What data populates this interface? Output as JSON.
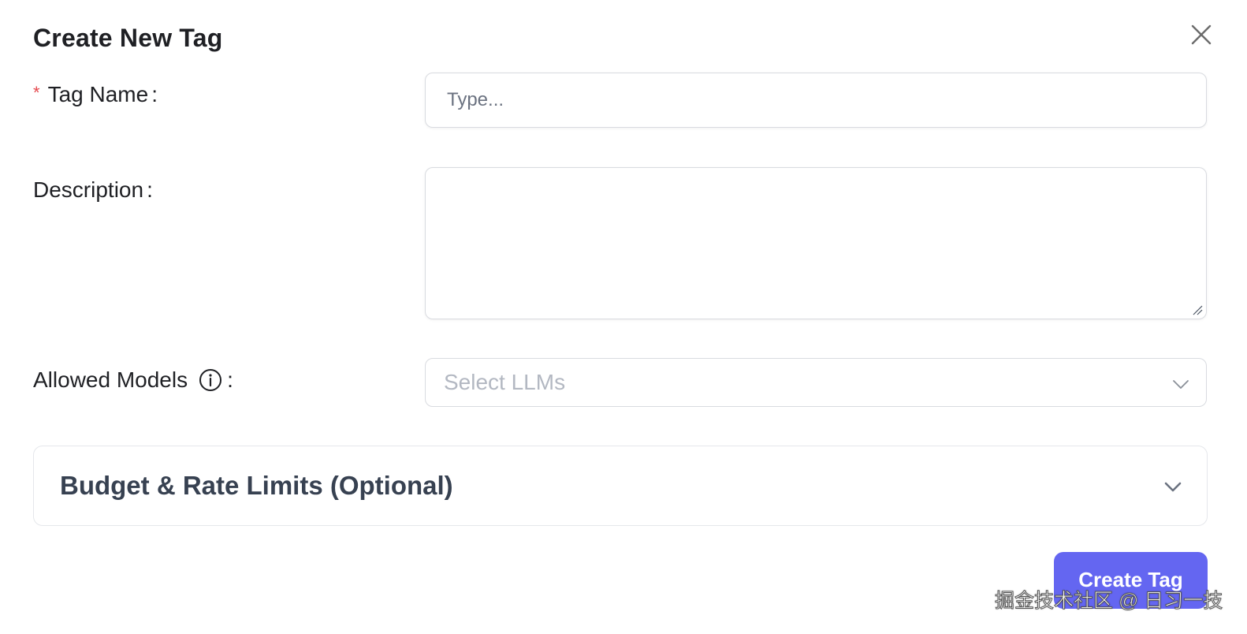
{
  "dialog": {
    "title": "Create New Tag"
  },
  "form": {
    "tag_name": {
      "label": "Tag Name",
      "required_marker": "*",
      "colon": ":",
      "placeholder": "Type...",
      "value": ""
    },
    "description": {
      "label": "Description",
      "colon": ":",
      "value": ""
    },
    "allowed_models": {
      "label": "Allowed Models",
      "colon": ":",
      "info_icon": "info-circle-icon",
      "placeholder": "Select LLMs",
      "chevron_icon": "chevron-down-icon"
    }
  },
  "accordion": {
    "title": "Budget & Rate Limits (Optional)",
    "expanded": false,
    "chevron_icon": "chevron-down-icon"
  },
  "actions": {
    "submit_label": "Create Tag"
  },
  "watermark": {
    "text": "掘金技术社区 @ 日习一技"
  },
  "colors": {
    "primary": "#6466f1",
    "required": "#e5484d",
    "border": "#d9dbe0",
    "placeholder": "#b3b8c2"
  }
}
